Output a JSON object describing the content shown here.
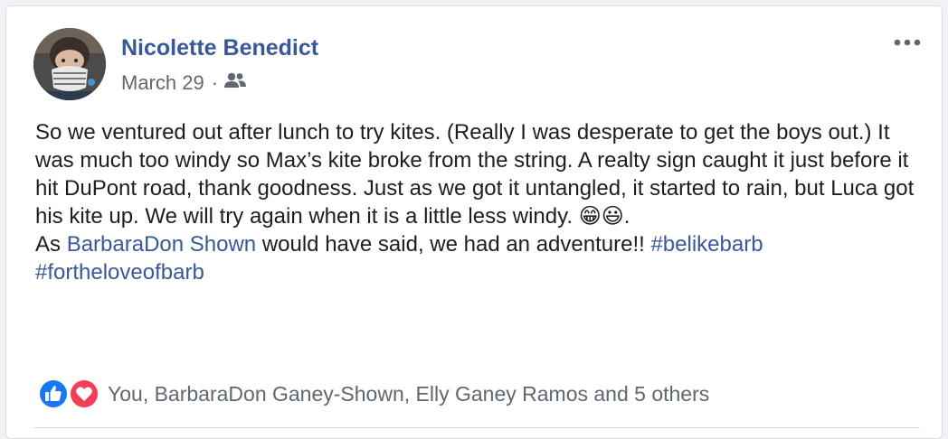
{
  "post": {
    "author": "Nicolette Benedict",
    "date": "March 29",
    "separator": "·",
    "audience_icon": "friends-icon",
    "more_icon": "more-options-icon",
    "text_line1": "So we ventured out after lunch to try kites. (Really I was desperate to get the boys out.) It was much too windy so Max’s kite broke from the string. A realty sign caught it just before it hit DuPont road, thank goodness. Just as we got it untangled, it started to rain, but Luca got his kite up. We will try again when it is a little less windy. ",
    "emoji_grin": "😁",
    "emoji_smile": "😃",
    "line1_end": ".",
    "line2_prefix": "As ",
    "mention": "BarbaraDon Shown",
    "line2_middle": " would have said, we had an adventure!! ",
    "hashtag1": "#belikebarb",
    "hashtag2": "#fortheloveofbarb"
  },
  "reactions": {
    "icons": [
      "like-icon",
      "love-icon"
    ],
    "summary": "You, BarbaraDon Ganey-Shown, Elly Ganey Ramos and 5 others"
  },
  "colors": {
    "link": "#385898",
    "like": "#1877f2",
    "love": "#f33e58",
    "meta": "#606770"
  }
}
